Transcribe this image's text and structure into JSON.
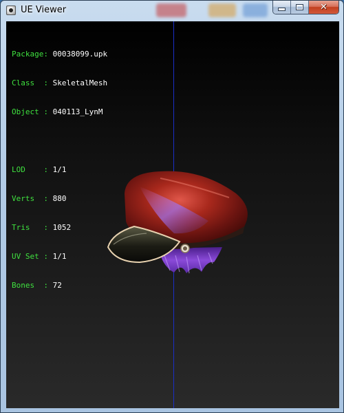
{
  "window": {
    "title": "UE Viewer",
    "accent": "#1a2fc9"
  },
  "titlebar_icons": {
    "app": "ue-viewer-icon",
    "minimize": "minimize-icon",
    "maximize": "maximize-icon",
    "close": "close-icon",
    "close_glyph": "✕"
  },
  "info": {
    "package": {
      "key": "Package:",
      "value": "00038099.upk"
    },
    "class": {
      "key": "Class  :",
      "value": "SkeletalMesh"
    },
    "object": {
      "key": "Object :",
      "value": "040113_LynM"
    },
    "lod": {
      "key": "LOD    :",
      "value": "1/1"
    },
    "verts": {
      "key": "Verts  :",
      "value": "880"
    },
    "tris": {
      "key": "Tris   :",
      "value": "1052"
    },
    "uvset": {
      "key": "UV Set :",
      "value": "1/1"
    },
    "bones": {
      "key": "Bones  :",
      "value": "72"
    }
  },
  "colors": {
    "label_green": "#3fe13f",
    "value_white": "#ffffff",
    "hat_red": "#8e1f17",
    "hair_purple": "#7b3fc4"
  }
}
